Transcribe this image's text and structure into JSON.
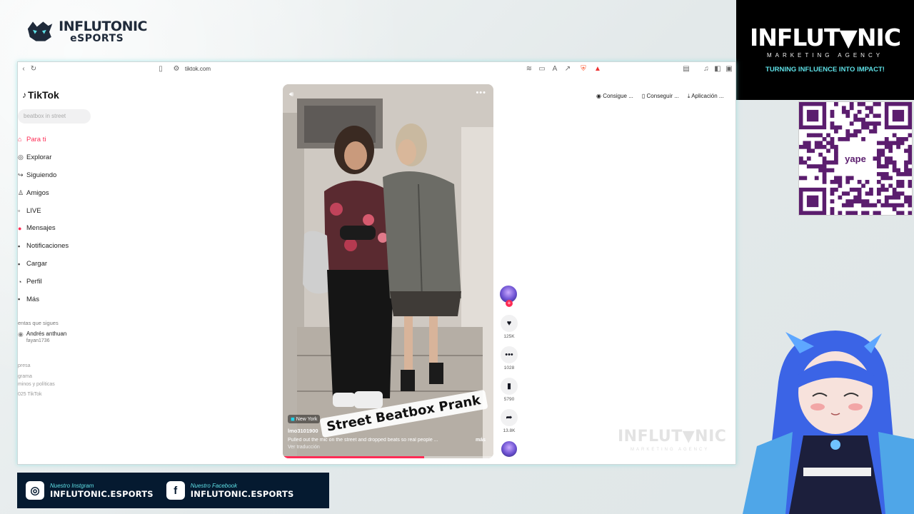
{
  "overlay": {
    "logo_line1": "INFLUTONIC",
    "logo_line2": "eSPORTS",
    "agency_name": "INFLUT▼NIC",
    "agency_sub": "MARKETING AGENCY",
    "agency_tagline": "TURNING INFLUENCE INTO IMPACT!",
    "qr_label": "yape",
    "watermark": "INFLUT▼NIC",
    "watermark_sub": "MARKETING AGENCY",
    "social": [
      {
        "label": "Nuestro Instgram",
        "value": "INFLUTONIC.ESPORTS",
        "icon": "instagram-icon"
      },
      {
        "label": "Nuestro Facebook",
        "value": "INFLUTONIC.ESPORTS",
        "icon": "facebook-icon"
      }
    ],
    "accent": "#5ee0e6"
  },
  "browser": {
    "url": "tiktok.com"
  },
  "tiktok": {
    "logo": "TikTok",
    "search_placeholder": "beatbox in street",
    "nav": [
      {
        "label": "Para ti",
        "icon": "home-icon",
        "active": true
      },
      {
        "label": "Explorar",
        "icon": "compass-icon"
      },
      {
        "label": "Siguiendo",
        "icon": "following-icon"
      },
      {
        "label": "Amigos",
        "icon": "friends-icon"
      },
      {
        "label": "LIVE",
        "icon": "live-icon"
      },
      {
        "label": "Mensajes",
        "icon": "messages-icon"
      },
      {
        "label": "Notificaciones",
        "icon": "bell-icon"
      },
      {
        "label": "Cargar",
        "icon": "upload-icon"
      },
      {
        "label": "Perfil",
        "icon": "profile-icon"
      },
      {
        "label": "Más",
        "icon": "more-icon"
      }
    ],
    "following_header": "entas que sigues",
    "following_user": {
      "name": "Andrés anthuan",
      "handle": "fayan1736"
    },
    "footer": [
      "presa",
      "grama",
      "minos y políticas",
      "025 TikTok"
    ],
    "top_links": [
      "Consigue ...",
      "Conseguir ...",
      "Aplicación ..."
    ],
    "video": {
      "caption_overlay": "Street Beatbox Prank",
      "location": "New York",
      "author": "lmo3101900",
      "description": "Pulled out the mic on the street and dropped beats so real people ...",
      "more": "más",
      "translate": "Ver traducción",
      "progress": 0.67
    },
    "actions": [
      {
        "icon": "heart-icon",
        "count": "125K"
      },
      {
        "icon": "comment-icon",
        "count": "1028"
      },
      {
        "icon": "bookmark-icon",
        "count": "5790"
      },
      {
        "icon": "share-icon",
        "count": "13.8K"
      }
    ],
    "brand_color": "#fe2c55"
  }
}
